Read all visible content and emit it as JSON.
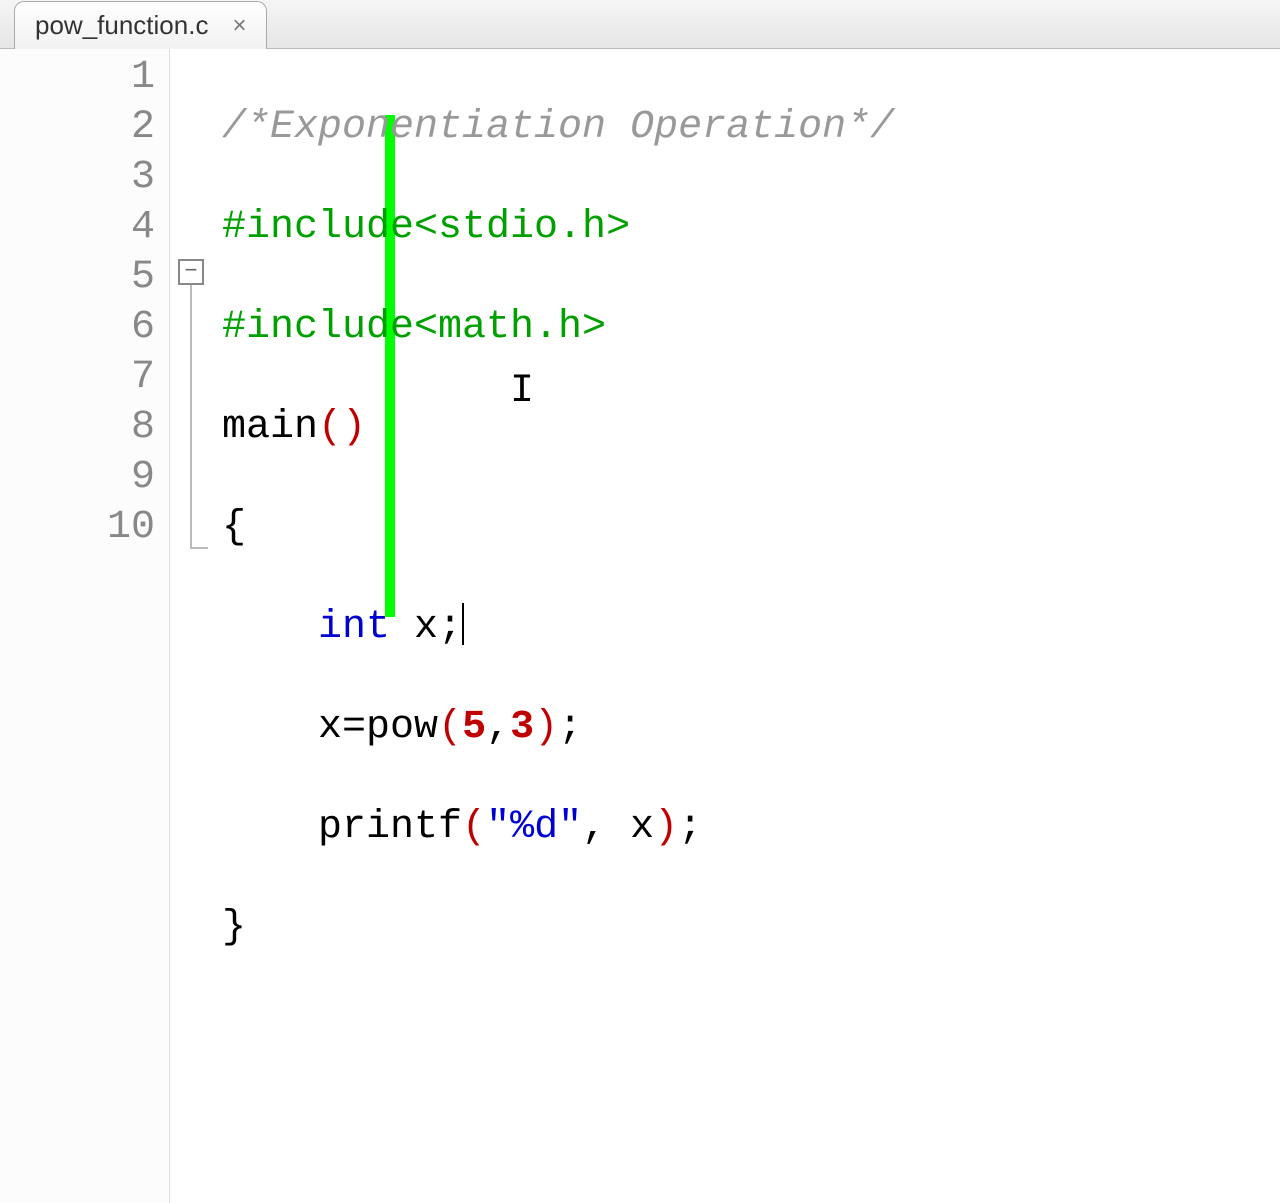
{
  "tab": {
    "filename": "pow_function.c",
    "close_glyph": "×"
  },
  "fold": {
    "symbol": "−"
  },
  "gutter": {
    "lines": [
      "1",
      "2",
      "3",
      "4",
      "5",
      "6",
      "7",
      "8",
      "9",
      "10"
    ]
  },
  "code": {
    "l1_comment": "/*Exponentiation Operation*/",
    "l2_include": "#include<stdio.h>",
    "l3_include": "#include<math.h>",
    "l4_main": "main",
    "l4_paren_open": "(",
    "l4_paren_close": ")",
    "l5_brace_open": "{",
    "l6_kw": "int",
    "l6_var": " x",
    "l6_semi": ";",
    "l7_lhs": "x",
    "l7_eq": "=",
    "l7_fn": "pow",
    "l7_po": "(",
    "l7_a1": "5",
    "l7_comma": ",",
    "l7_a2": "3",
    "l7_pc": ")",
    "l7_semi": ";",
    "l8_fn": "printf",
    "l8_po": "(",
    "l8_str": "\"%d\"",
    "l8_comma": ",",
    "l8_arg": " x",
    "l8_pc": ")",
    "l8_semi": ";",
    "l9_brace_close": "}"
  }
}
